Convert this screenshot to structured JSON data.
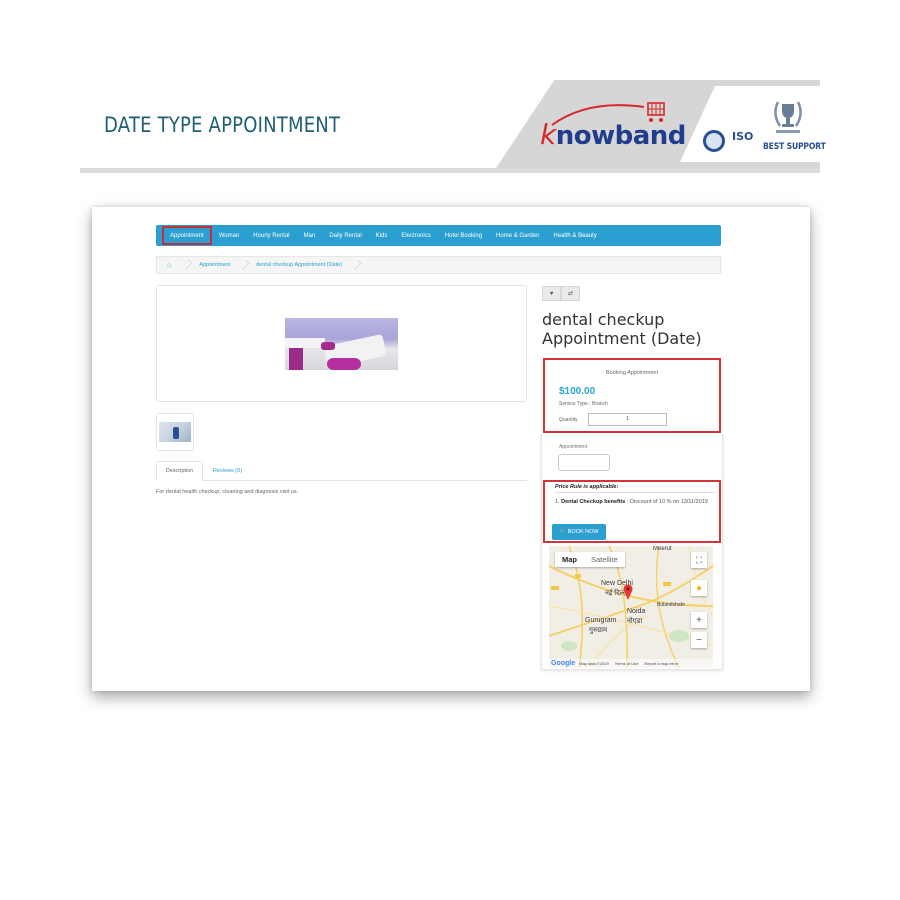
{
  "banner": {
    "title": "DATE TYPE APPOINTMENT",
    "logo_initial": "k",
    "logo_rest": "nowband",
    "badge_iso": "ISO",
    "badge_best": "BEST SUPPORT"
  },
  "nav": {
    "items": [
      "Appointment",
      "Woman",
      "Hourly Rental",
      "Man",
      "Daily Rental",
      "Kids",
      "Electronics",
      "Hotel Booking",
      "Home & Garden",
      "Health & Beauty"
    ],
    "active_index": 0,
    "color": "#2a9fd0"
  },
  "breadcrumb": {
    "home_icon": "home-icon",
    "items": [
      "Appointment",
      "dental checkup Appointment (Date)"
    ]
  },
  "product": {
    "title": "dental checkup Appointment (Date)",
    "wishlist_icon": "heart-icon",
    "compare_icon": "compare-icon",
    "tabs": [
      {
        "label": "Description",
        "active": true
      },
      {
        "label": "Reviews (0)",
        "active": false
      }
    ],
    "description": "For dental health checkup, cleaning and diagnosis visit us."
  },
  "booking": {
    "title": "Booking Appointment",
    "price": "$100.00",
    "price_color": "#26a7d4",
    "service_type": "Service Type : Branch",
    "quantity_label": "Quantity",
    "quantity_value": "1",
    "appointment_label": "Appointment",
    "appointment_value": ""
  },
  "price_rule": {
    "title": "Price Rule is applicable:",
    "number": "1.",
    "name": "Dental Checkup benefits",
    "text": ": Discount of 10 % on 13/11/2019",
    "button": "BOOK NOW",
    "highlight_color": "#d3343c"
  },
  "map": {
    "type_options": [
      "Map",
      "Satellite"
    ],
    "selected_type": "Map",
    "labels": {
      "new_delhi": "New Delhi",
      "new_delhi_hi": "नई दिल्ली",
      "noida": "Noida",
      "noida_hi": "नोएडा",
      "gurugram": "Gurugram",
      "gurugram_hi": "गुरुग्राम",
      "meerut": "Meerut",
      "bulandshahr": "Bulandshahr"
    },
    "footer": {
      "brand": "Google",
      "data": "Map data ©2019",
      "terms": "Terms of Use",
      "report": "Report a map error"
    }
  }
}
